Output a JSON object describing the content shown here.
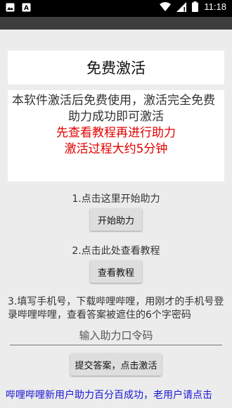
{
  "status_bar": {
    "time": "11:18",
    "icons_left": [
      "notification-image-icon",
      "notification-app-icon"
    ],
    "icons_right": [
      "wifi-icon",
      "signal-icon",
      "battery-icon"
    ]
  },
  "title": "免费激活",
  "info": {
    "line1": "本软件激活后免费使用，激活完全免费",
    "line2": "助力成功即可激活",
    "line3": "先查看教程再进行助力",
    "line4": "激活过程大约5分钟"
  },
  "step1": {
    "label": "1.点击这里开始助力",
    "button": "开始助力"
  },
  "step2": {
    "label": "2.点击此处查看教程",
    "button": "查看教程"
  },
  "step3": {
    "text": "3.填写手机号，下载哔哩哔哩，用刚才的手机号登录哔哩哔哩，查看答案被遮住的6个字密码",
    "placeholder": "输入助力口令码",
    "submit": "提交答案，点击激活"
  },
  "bottom_link": "哔哩哔哩新用户助力百分百成功，老用户请点击",
  "colors": {
    "accent_red": "#e00000",
    "link_blue": "#1a17d6",
    "background": "#ececec"
  }
}
